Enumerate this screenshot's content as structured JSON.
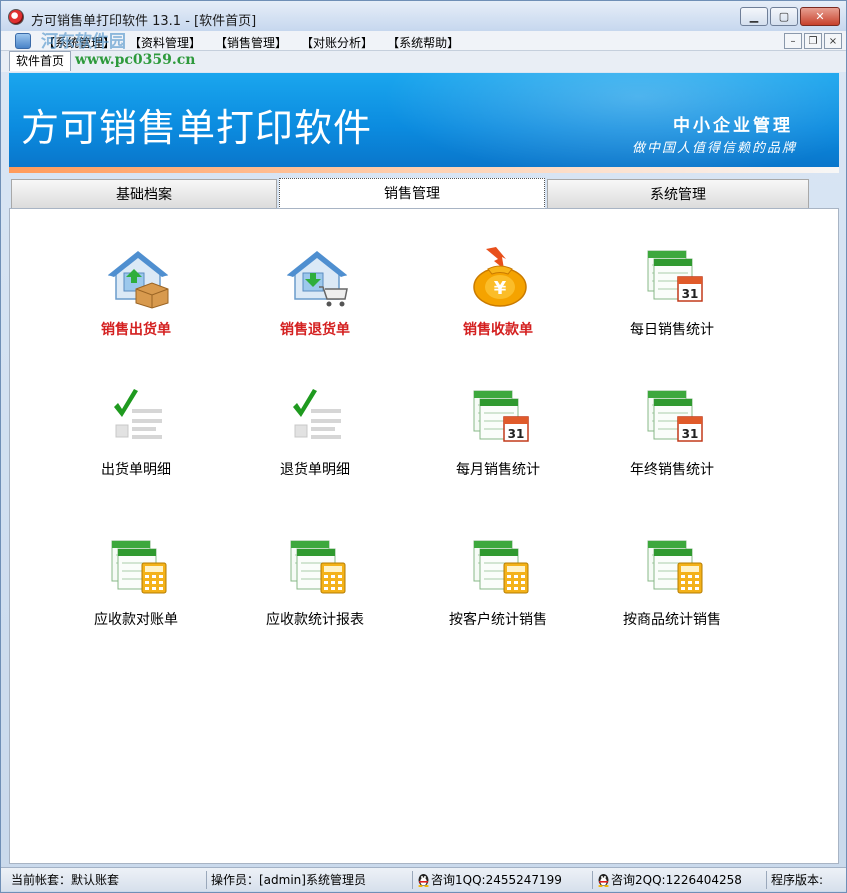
{
  "window": {
    "title": "方可销售单打印软件 13.1 - [软件首页]"
  },
  "menu": {
    "items": [
      "【系统管理】",
      "【资料管理】",
      "【销售管理】",
      "【对账分析】",
      "【系统帮助】"
    ]
  },
  "doc_tab": {
    "label": "软件首页"
  },
  "watermark": {
    "url": "www.pc0359.cn",
    "text": "河东软件园"
  },
  "banner": {
    "title": "方可销售单打印软件",
    "subtitle1": "中小企业管理",
    "subtitle2": "做中国人值得信赖的品牌"
  },
  "tabs": [
    "基础档案",
    "销售管理",
    "系统管理"
  ],
  "active_tab": 1,
  "items": [
    {
      "label": "销售出货单",
      "icon": "house-box-icon",
      "highlight": true
    },
    {
      "label": "销售退货单",
      "icon": "house-cart-icon",
      "highlight": true
    },
    {
      "label": "销售收款单",
      "icon": "money-bag-icon",
      "highlight": true
    },
    {
      "label": "每日销售统计",
      "icon": "calendar-report-icon",
      "highlight": false
    },
    {
      "label": "出货单明细",
      "icon": "checklist-icon",
      "highlight": false
    },
    {
      "label": "退货单明细",
      "icon": "checklist-icon",
      "highlight": false
    },
    {
      "label": "每月销售统计",
      "icon": "calendar-report-icon",
      "highlight": false
    },
    {
      "label": "年终销售统计",
      "icon": "calendar-report-icon",
      "highlight": false
    },
    {
      "label": "应收款对账单",
      "icon": "calculator-report-icon",
      "highlight": false
    },
    {
      "label": "应收款统计报表",
      "icon": "calculator-report-icon",
      "highlight": false
    },
    {
      "label": "按客户统计销售",
      "icon": "calculator-report-icon",
      "highlight": false
    },
    {
      "label": "按商品统计销售",
      "icon": "calculator-report-icon",
      "highlight": false
    }
  ],
  "icon_text": {
    "calendar_day": "31",
    "currency": "¥"
  },
  "status": {
    "account": "当前帐套：默认账套",
    "operator": "操作员：[admin]系统管理员",
    "qq1": "咨询1QQ:2455247199",
    "qq2": "咨询2QQ:1226404258",
    "version": "程序版本:"
  },
  "colors": {
    "banner": "#0b8bdf",
    "highlight_label": "#d42020"
  }
}
